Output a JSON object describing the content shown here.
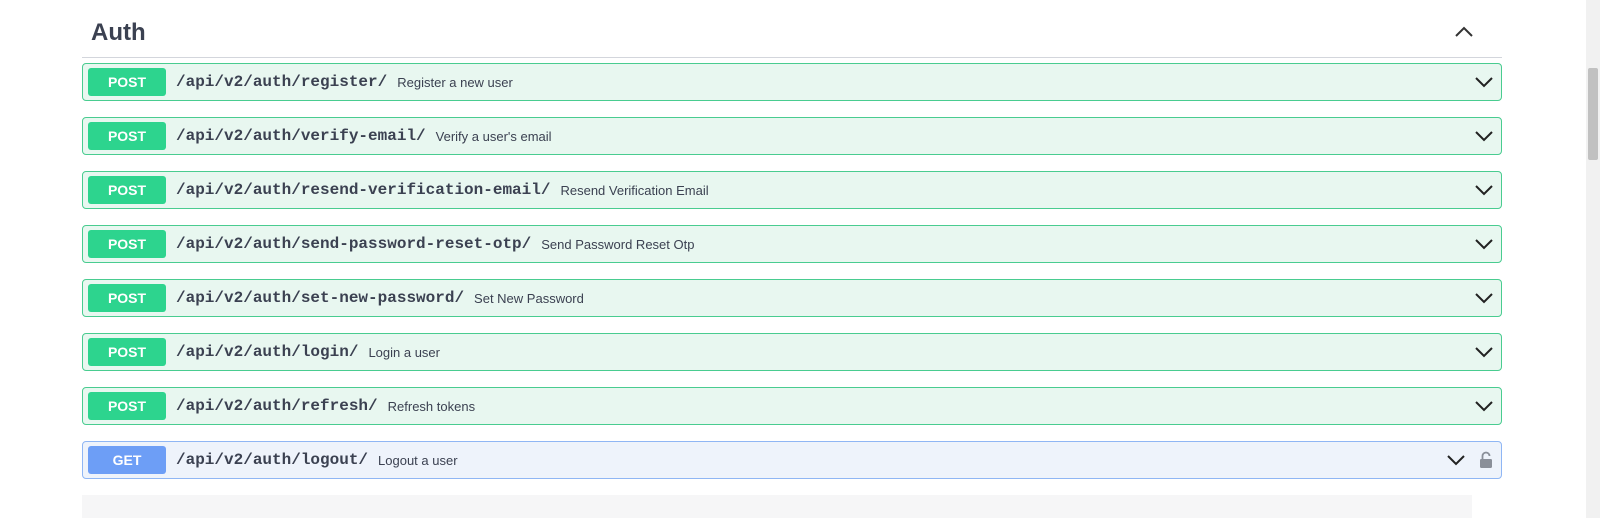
{
  "section": {
    "title": "Auth",
    "collapse_icon": "chevron-up-icon"
  },
  "operations": [
    {
      "method": "POST",
      "path": "/api/v2/auth/register/",
      "summary": "Register a new user"
    },
    {
      "method": "POST",
      "path": "/api/v2/auth/verify-email/",
      "summary": "Verify a user's email"
    },
    {
      "method": "POST",
      "path": "/api/v2/auth/resend-verification-email/",
      "summary": "Resend Verification Email"
    },
    {
      "method": "POST",
      "path": "/api/v2/auth/send-password-reset-otp/",
      "summary": "Send Password Reset Otp"
    },
    {
      "method": "POST",
      "path": "/api/v2/auth/set-new-password/",
      "summary": "Set New Password"
    },
    {
      "method": "POST",
      "path": "/api/v2/auth/login/",
      "summary": "Login a user"
    },
    {
      "method": "POST",
      "path": "/api/v2/auth/refresh/",
      "summary": "Refresh tokens"
    },
    {
      "method": "GET",
      "path": "/api/v2/auth/logout/",
      "summary": "Logout a user",
      "icon": "lock-icon"
    }
  ],
  "colors": {
    "post_badge": "#2dd48e",
    "post_bg": "#e8f7f0",
    "post_border": "#49cc90",
    "get_badge": "#6d9ef6",
    "get_bg": "#eef3fb",
    "get_border": "#8fb6f4"
  }
}
